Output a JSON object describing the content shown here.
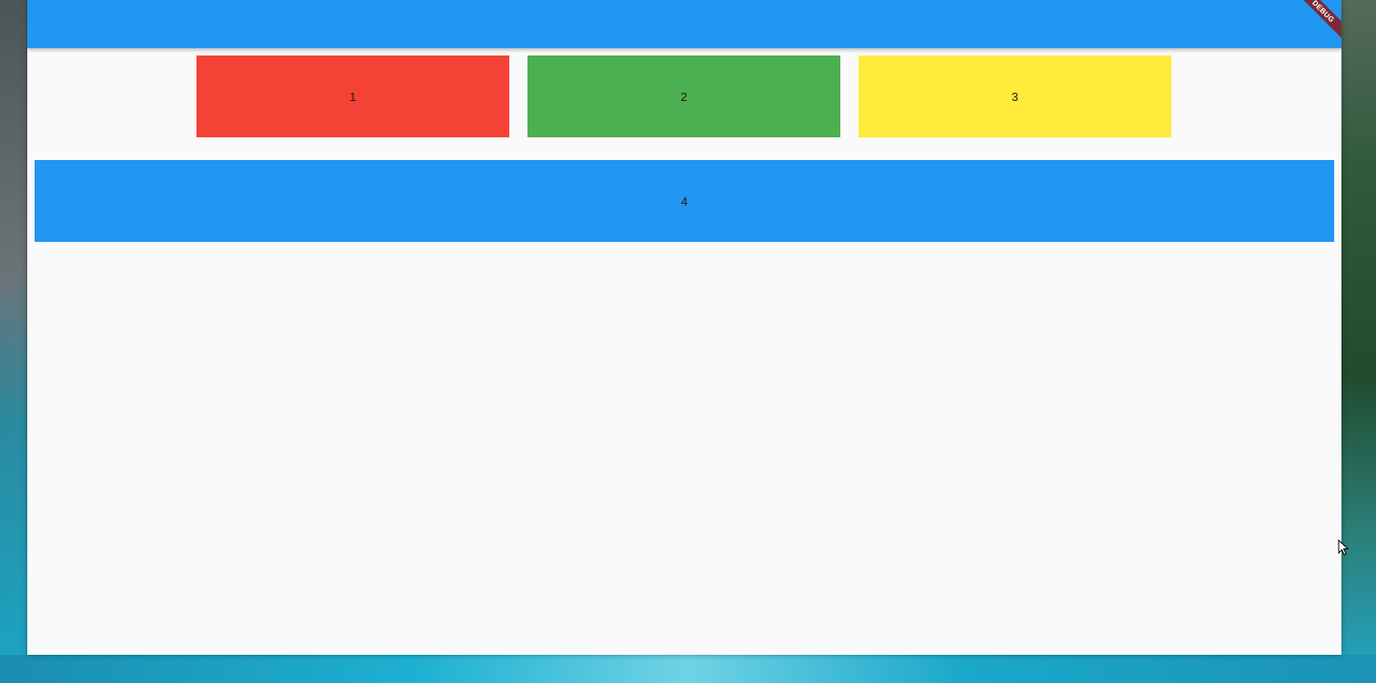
{
  "banner": {
    "label": "DEBUG"
  },
  "colors": {
    "appbar": "#2196f3",
    "box1": "#f44336",
    "box2": "#4caf50",
    "box3": "#ffeb3b",
    "box4": "#2196f3",
    "background": "#fafafa",
    "debug_banner": "#7b2a3a"
  },
  "boxes": [
    {
      "label": "1",
      "color": "#f44336"
    },
    {
      "label": "2",
      "color": "#4caf50"
    },
    {
      "label": "3",
      "color": "#ffeb3b"
    },
    {
      "label": "4",
      "color": "#2196f3"
    }
  ],
  "cursor": {
    "icon": "mouse-pointer-icon"
  }
}
